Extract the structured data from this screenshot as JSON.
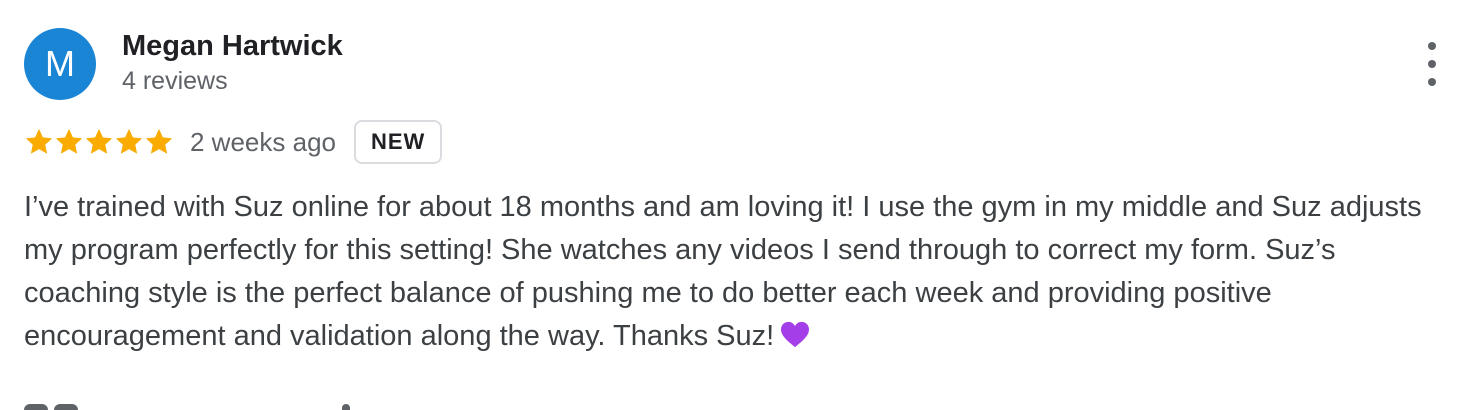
{
  "reviewer": {
    "initial": "M",
    "name": "Megan Hartwick",
    "review_count": "4 reviews",
    "avatar_color": "#1b85d5"
  },
  "review": {
    "rating": 5,
    "rating_max": 5,
    "date": "2 weeks ago",
    "badge": "NEW",
    "text": "I’ve trained with Suz online for about 18 months and am loving it! I use the gym in my middle and Suz adjusts my program perfectly for this setting! She watches any videos I send through to correct my form. Suz’s coaching style is the perfect balance of pushing me to do better each week and providing positive encouragement and validation along the way. Thanks Suz!",
    "emoji": "purple-heart-icon"
  },
  "icons": {
    "more": "more-vert-icon",
    "star": "star-icon"
  },
  "colors": {
    "star": "#f9ab00",
    "heart": "#a33ee8",
    "text": "#3c4043",
    "secondary": "#5f6368"
  }
}
